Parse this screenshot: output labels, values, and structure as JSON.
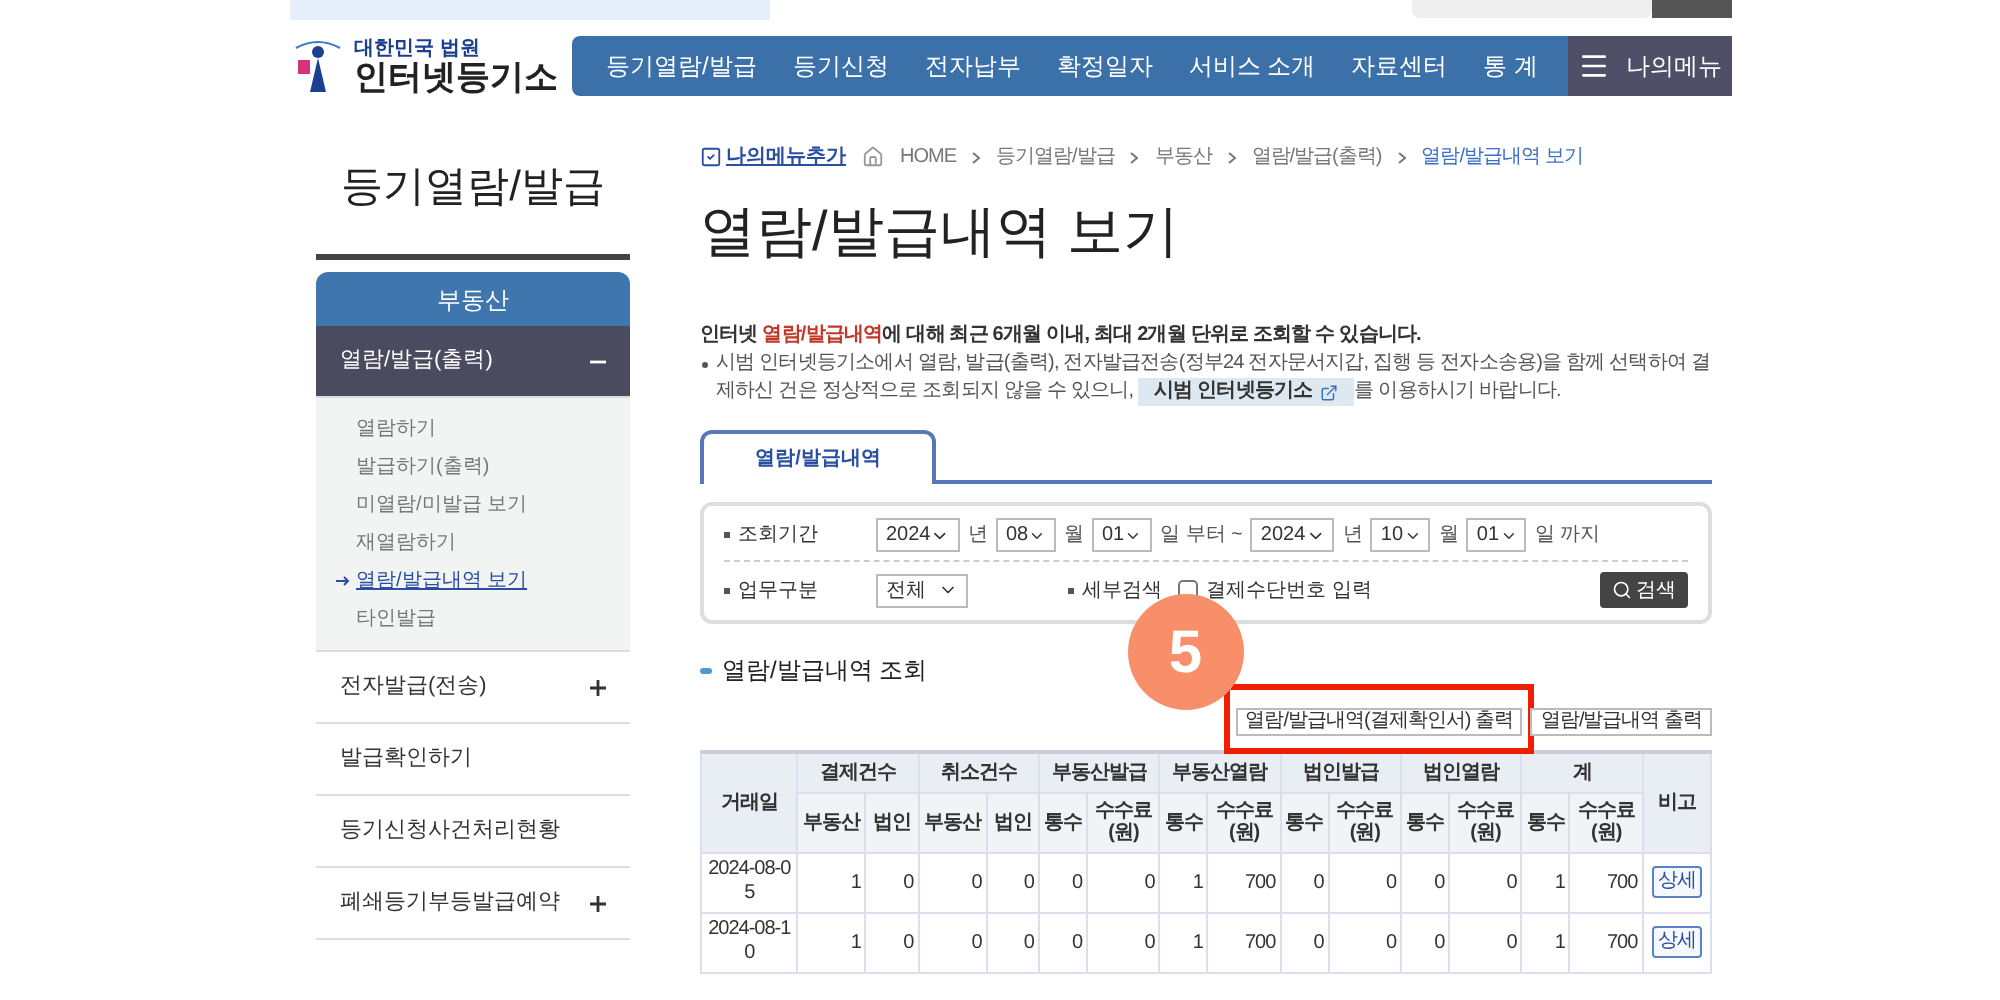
{
  "logo": {
    "subtitle": "대한민국 법원",
    "title": "인터넷등기소"
  },
  "nav": [
    {
      "label": "등기열람/발급",
      "selected": false
    },
    {
      "label": "등기신청",
      "selected": false
    },
    {
      "label": "전자납부",
      "selected": false
    },
    {
      "label": "확정일자",
      "selected": false
    },
    {
      "label": "서비스 소개",
      "selected": false
    },
    {
      "label": "자료센터",
      "selected": false
    },
    {
      "label": "통 계",
      "selected": false
    }
  ],
  "my_menu": "나의메뉴",
  "sidebar": {
    "title": "등기열람/발급",
    "category": "부동산",
    "groups": [
      {
        "label": "열람/발급(출력)",
        "kind": "expandable",
        "expanded": true,
        "children": [
          {
            "label": "열람하기",
            "selected": false
          },
          {
            "label": "발급하기(출력)",
            "selected": false
          },
          {
            "label": "미열람/미발급 보기",
            "selected": false
          },
          {
            "label": "재열람하기",
            "selected": false
          },
          {
            "label": "열람/발급내역 보기",
            "selected": true
          },
          {
            "label": "타인발급",
            "selected": false
          }
        ]
      },
      {
        "label": "전자발급(전송)",
        "kind": "expandable",
        "expanded": false
      },
      {
        "label": "발급확인하기",
        "kind": "link"
      },
      {
        "label": "등기신청사건처리현황",
        "kind": "link"
      },
      {
        "label": "폐쇄등기부등발급예약",
        "kind": "expandable",
        "expanded": false
      }
    ]
  },
  "breadcrumb": {
    "add_menu": "나의메뉴추가",
    "items": [
      {
        "label": "HOME",
        "selected": false
      },
      {
        "label": "등기열람/발급",
        "selected": false
      },
      {
        "label": "부동산",
        "selected": false
      },
      {
        "label": "열람/발급(출력)",
        "selected": false
      },
      {
        "label": "열람/발급내역 보기",
        "selected": true
      }
    ]
  },
  "page_title": "열람/발급내역 보기",
  "notice": {
    "intro": "인터넷 **열람/발급내역**에 대해 최근 6개월 이내, 최대 2개월 단위로 조회할 수 있습니다.",
    "bullet_before": "시범 인터넷등기소에서 열람, 발급(출력), 전자발급전송(정부24 전자문서지갑, 집행 등 전자소송용)을 함께 선택하여 결제하신 건은 정상적으로 조회되지 않을 수 있으니,",
    "bullet_link": "시범 인터넷등기소",
    "bullet_after": "를 이용하시기 바랍니다."
  },
  "tabs": [
    {
      "label": "열람/발급내역",
      "selected": true
    }
  ],
  "search": {
    "period_label": "조회기간",
    "period": [
      {
        "value": "2024",
        "unit": "년"
      },
      {
        "value": "08",
        "unit": "월"
      },
      {
        "value": "01",
        "unit": "일 부터 ~"
      },
      {
        "value": "2024",
        "unit": "년"
      },
      {
        "value": "10",
        "unit": "월"
      },
      {
        "value": "01",
        "unit": "일 까지"
      }
    ],
    "task_label": "업무구분",
    "task_value": "전체",
    "detail_label": "세부검색",
    "detail_checkbox": {
      "label": "결제수단번호 입력",
      "checked": false
    },
    "button": "검색"
  },
  "section_title": "열람/발급내역 조회",
  "print_buttons": [
    {
      "label": "열람/발급내역(결제확인서) 출력",
      "highlighted": true,
      "step": "5"
    },
    {
      "label": "열람/발급내역 출력",
      "highlighted": false
    }
  ],
  "table": {
    "date_header": "거래일",
    "groups": [
      {
        "label": "결제건수",
        "columns": [
          "부동산",
          "법인"
        ]
      },
      {
        "label": "취소건수",
        "columns": [
          "부동산",
          "법인"
        ]
      },
      {
        "label": "부동산발급",
        "columns": [
          "통수",
          "수수료 (원)"
        ]
      },
      {
        "label": "부동산열람",
        "columns": [
          "통수",
          "수수료 (원)"
        ]
      },
      {
        "label": "법인발급",
        "columns": [
          "통수",
          "수수료 (원)"
        ]
      },
      {
        "label": "법인열람",
        "columns": [
          "통수",
          "수수료 (원)"
        ]
      },
      {
        "label": "계",
        "columns": [
          "통수",
          "수수료 (원)"
        ]
      }
    ],
    "note_header": "비고",
    "rows": [
      {
        "date": "2024-08-05",
        "cells": [
          "1",
          "0",
          "0",
          "0",
          "0",
          "0",
          "1",
          "700",
          "0",
          "0",
          "0",
          "0",
          "1",
          "700"
        ],
        "action": "상세"
      },
      {
        "date": "2024-08-10",
        "cells": [
          "1",
          "0",
          "0",
          "0",
          "0",
          "0",
          "1",
          "700",
          "0",
          "0",
          "0",
          "0",
          "1",
          "700"
        ],
        "action": "상세"
      }
    ]
  }
}
